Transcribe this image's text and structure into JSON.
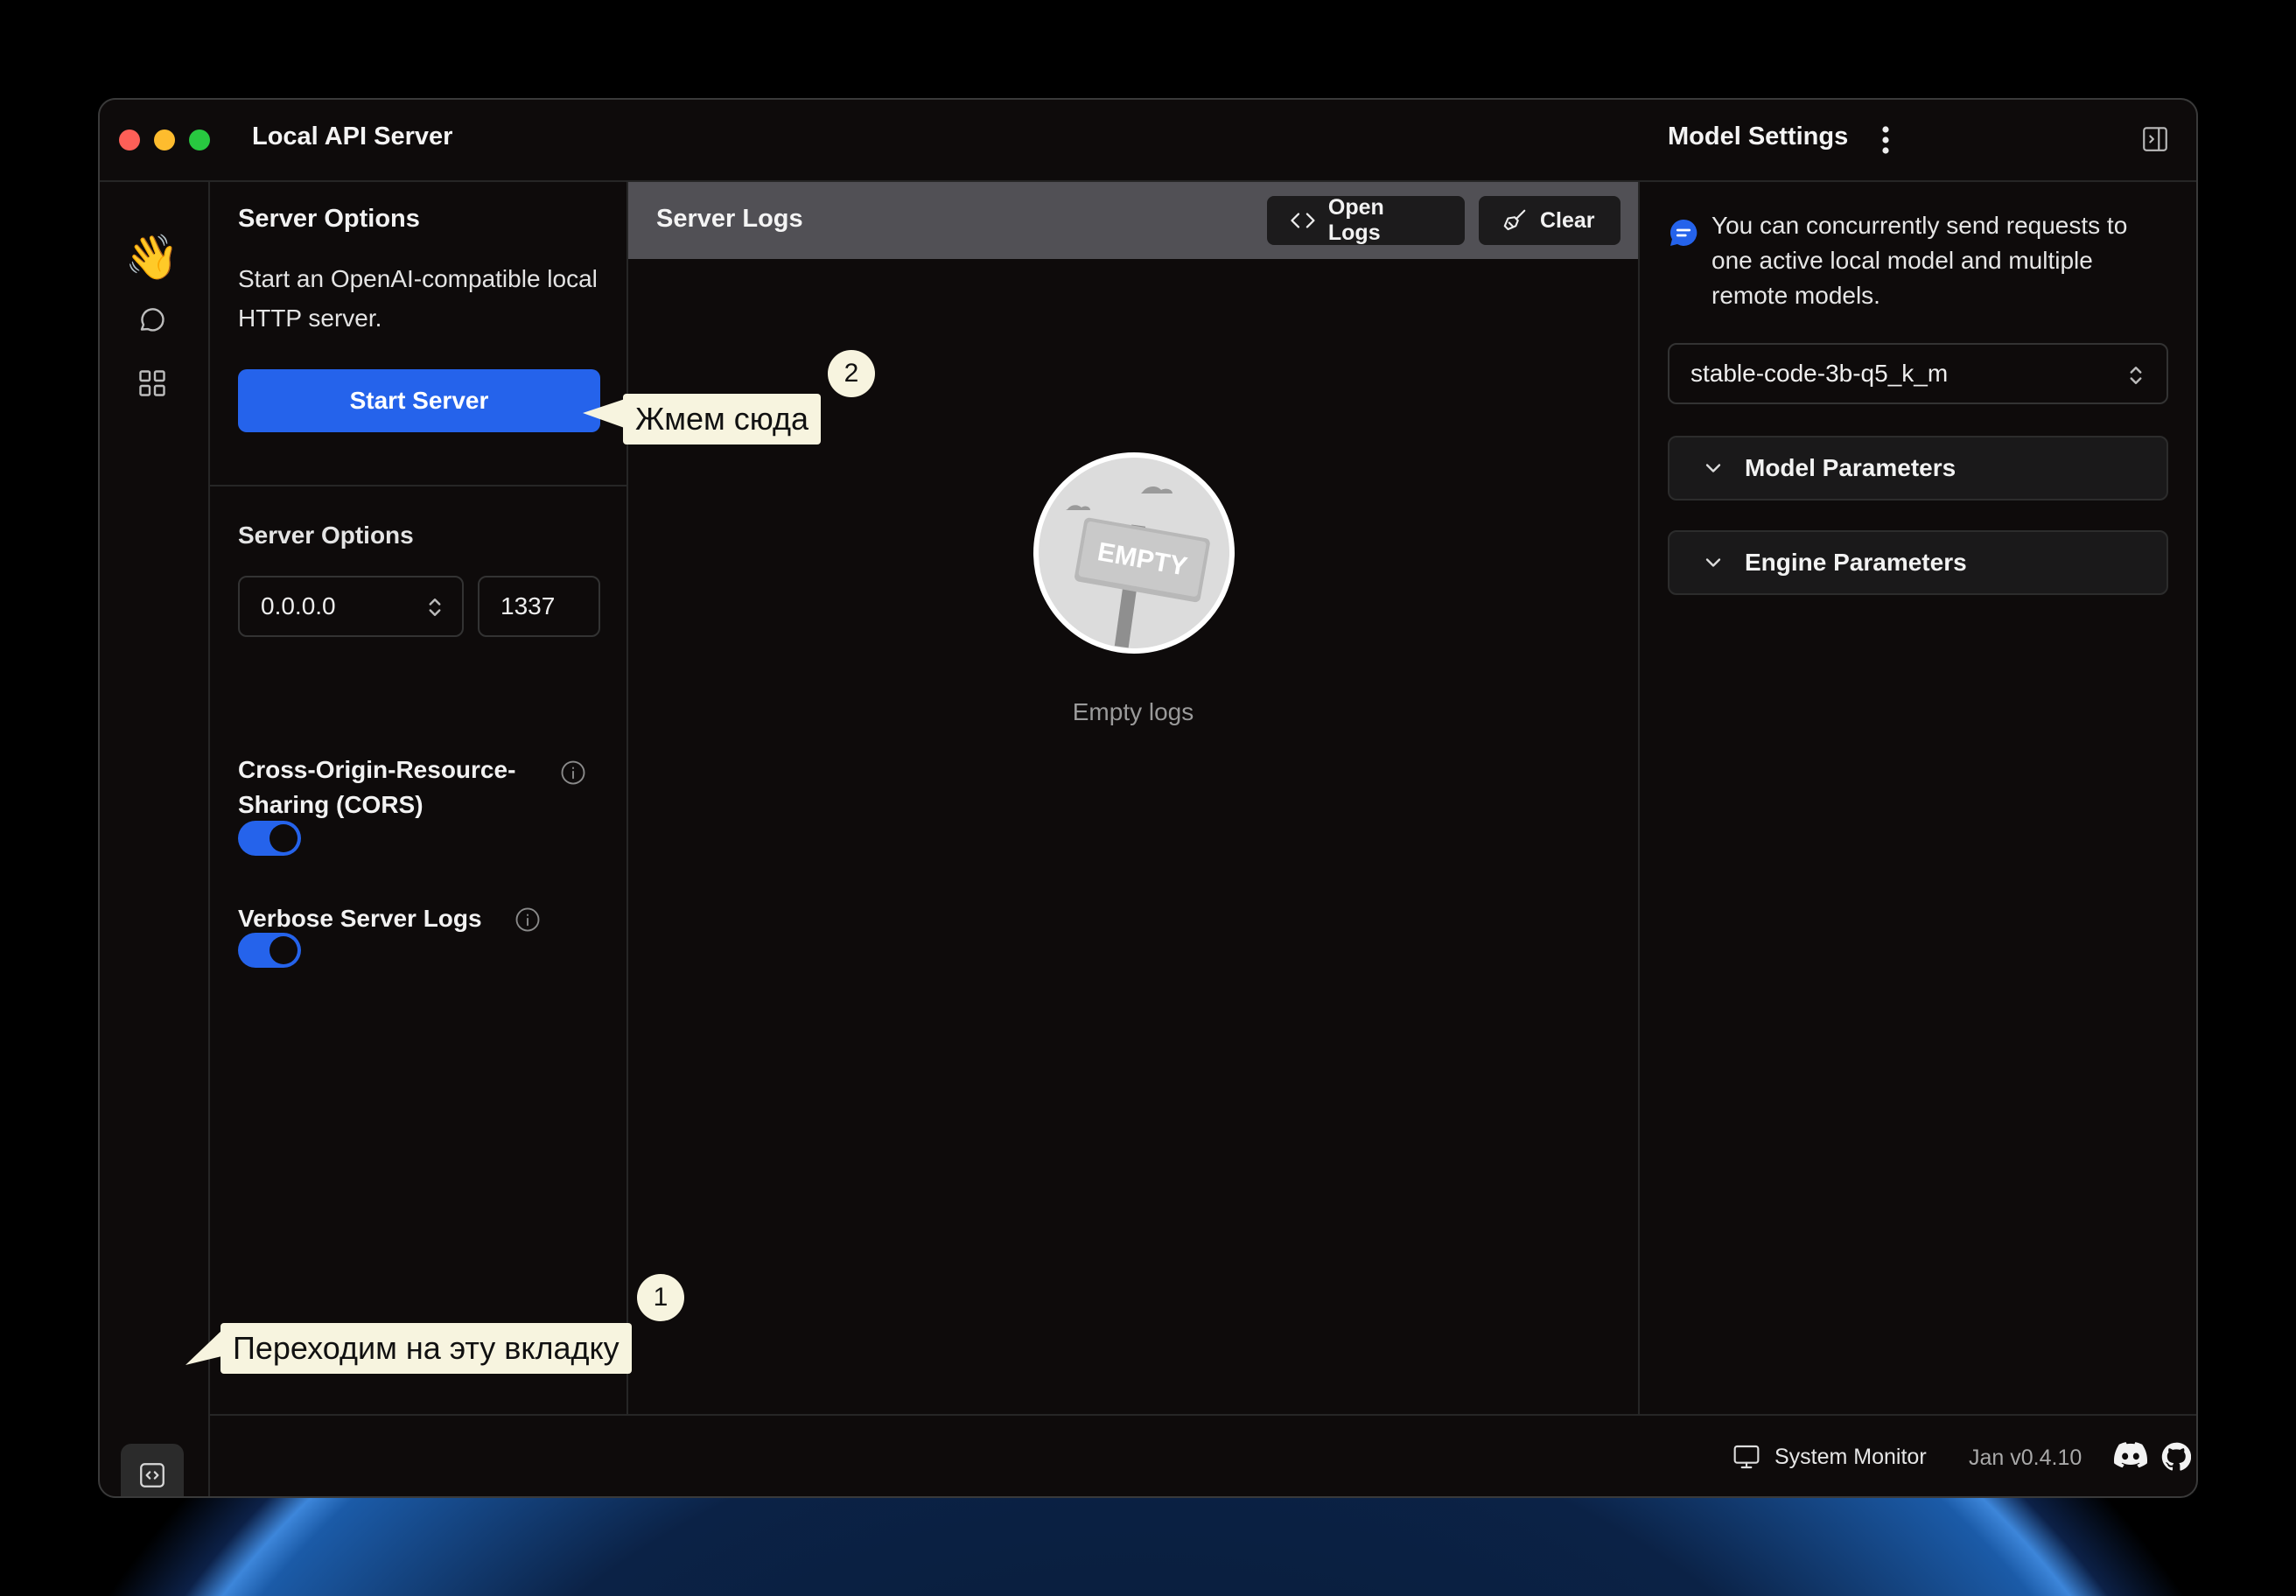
{
  "window": {
    "title": "Local API Server"
  },
  "rail": {
    "items": [
      "hand-wave-icon",
      "chat-icon",
      "apps-grid-icon",
      "code-icon",
      "gear-icon"
    ],
    "active": "code-icon"
  },
  "server_options": {
    "heading": "Server Options",
    "description": "Start an OpenAI-compatible local HTTP server.",
    "start_button": "Start Server",
    "section_label": "Server Options",
    "host": "0.0.0.0",
    "port": "1337",
    "cors_label": "Cross-Origin-Resource-Sharing (CORS)",
    "cors_enabled": true,
    "verbose_label": "Verbose Server Logs",
    "verbose_enabled": true
  },
  "logs": {
    "title": "Server Logs",
    "open_logs_label": "Open Logs",
    "clear_label": "Clear",
    "empty_sign_text": "EMPTY",
    "empty_text": "Empty logs"
  },
  "model_settings": {
    "title": "Model Settings",
    "notice": "You can concurrently send requests to one active local model and multiple remote models.",
    "selected_model": "stable-code-3b-q5_k_m",
    "sections": [
      "Model Parameters",
      "Engine Parameters"
    ]
  },
  "status_bar": {
    "system_monitor_label": "System Monitor",
    "version": "Jan v0.4.10"
  },
  "annotations": [
    {
      "number": "1",
      "text": "Переходим на эту вкладку"
    },
    {
      "number": "2",
      "text": "Жмем сюда"
    }
  ],
  "colors": {
    "accent": "#2563eb",
    "window_bg": "#0e0b0b",
    "logs_header": "#515055",
    "callout_bg": "#f7f4df"
  }
}
